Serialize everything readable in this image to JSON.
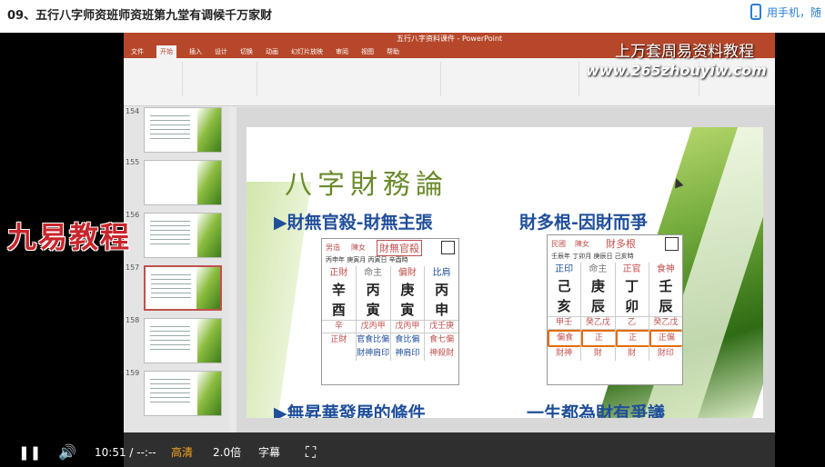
{
  "page": {
    "title": "09、五行八字师资班师资班第九堂有调候千万家财",
    "phone_label": "用手机，随"
  },
  "ppt": {
    "file_title": "五行八字资料课件 - PowerPoint",
    "tabs": [
      "文件",
      "开始",
      "插入",
      "设计",
      "切换",
      "动画",
      "幻灯片放映",
      "审阅",
      "视图",
      "帮助"
    ],
    "slide_numbers": [
      "154",
      "155",
      "156",
      "157",
      "158",
      "159"
    ]
  },
  "slide": {
    "title": "八字財務論",
    "heading_left": "▶財無官殺-財無主張",
    "heading_right": "財多根-因財而爭",
    "heading_bottom_left": "▶無昇華發展的條件",
    "heading_bottom_right": "一生都為財有爭議",
    "chart_left": {
      "gender": "男造",
      "name": "陳女",
      "tag": "財無官殺",
      "date_line": "丙申年 庚寅月 丙寅日 辛酉時",
      "gods": [
        "正財",
        "命主",
        "偏財",
        "比肩"
      ],
      "stems": [
        "辛",
        "丙",
        "庚",
        "丙"
      ],
      "branches": [
        "酉",
        "寅",
        "寅",
        "申"
      ],
      "hidden": [
        "辛",
        "戊丙甲",
        "戊丙甲",
        "戊壬庚"
      ],
      "hidden_gods": [
        "正財",
        "官食比偏",
        "食比偏",
        "食七偏"
      ],
      "hidden_gods_2": [
        "",
        "財神肩印",
        "神肩印",
        "神殺財"
      ]
    },
    "chart_right": {
      "gender": "民國",
      "name": "陳女",
      "tag": "財多根",
      "date_line": "壬辰年 丁卯月 庚辰日 己亥時",
      "gods": [
        "正印",
        "命主",
        "正官",
        "食神"
      ],
      "stems": [
        "己",
        "庚",
        "丁",
        "壬"
      ],
      "branches": [
        "亥",
        "辰",
        "卯",
        "辰"
      ],
      "hidden": [
        "甲壬",
        "癸乙戊",
        "乙",
        "癸乙戊"
      ],
      "hidden_gods": [
        "偏食",
        "正",
        "正",
        "正偏"
      ],
      "hidden_gods_2": [
        "財神",
        "財",
        "財",
        "財印"
      ]
    }
  },
  "player": {
    "time": "10:51 / --:--",
    "quality": "高清",
    "speed": "2.0倍",
    "subtitle": "字幕"
  },
  "watermark": {
    "right": "上万套周易资料教程",
    "url": "www.265zhouyiw.com",
    "left": "九易教程"
  }
}
